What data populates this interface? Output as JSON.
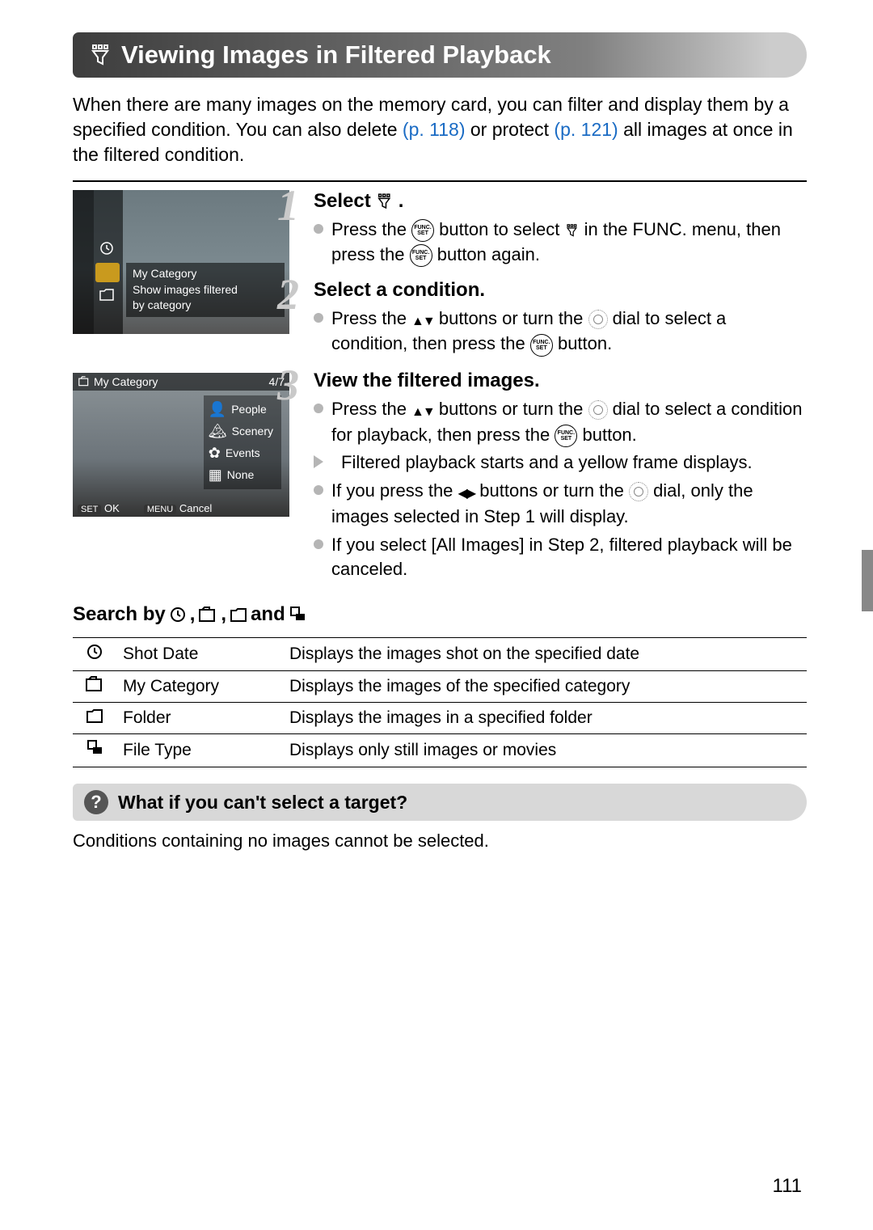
{
  "title": "Viewing Images in Filtered Playback",
  "intro": {
    "part1": "When there are many images on the memory card, you can filter and display them by a specified condition. You can also delete ",
    "link1": "(p. 118)",
    "part2": " or protect ",
    "link2": "(p. 121)",
    "part3": " all images at once in the filtered condition."
  },
  "screenshot1": {
    "line1": "My Category",
    "line2": "Show images filtered",
    "line3": "by category"
  },
  "screenshot2": {
    "header_left": "My Category",
    "header_right": "4/7",
    "items": [
      "People",
      "Scenery",
      "Events",
      "None"
    ],
    "footer_set": "SET",
    "footer_ok": "OK",
    "footer_menu": "MENU",
    "footer_cancel": "Cancel"
  },
  "steps": [
    {
      "num": "1",
      "title": "Select",
      "bullets": [
        {
          "type": "circle",
          "pre": "Press the ",
          "mid": " button to select ",
          "post": " in the FUNC. menu, then press the ",
          "end": " button again."
        }
      ]
    },
    {
      "num": "2",
      "title": "Select a condition.",
      "bullet1_pre": "Press the ",
      "bullet1_mid": " buttons or turn the ",
      "bullet1_mid2": " dial to select a condition, then press the ",
      "bullet1_end": " button."
    },
    {
      "num": "3",
      "title": "View the filtered images.",
      "b1_pre": "Press the ",
      "b1_mid": " buttons or turn the ",
      "b1_mid2": " dial to select a condition for playback, then press the ",
      "b1_end": " button.",
      "b2": "Filtered playback starts and a yellow frame displays.",
      "b3_pre": "If you press the ",
      "b3_mid": " buttons or turn the ",
      "b3_end": " dial, only the images selected in Step 1 will display.",
      "b4": "If you select [All Images] in Step 2, filtered playback will be canceled."
    }
  ],
  "search_heading_pre": "Search by ",
  "search_heading_post": " and ",
  "table": [
    {
      "name": "Shot Date",
      "desc": "Displays the images shot on the specified date"
    },
    {
      "name": "My Category",
      "desc": "Displays the images of the specified category"
    },
    {
      "name": "Folder",
      "desc": "Displays the images in a specified folder"
    },
    {
      "name": "File Type",
      "desc": "Displays only still images or movies"
    }
  ],
  "faq_title": "What if you can't select a target?",
  "faq_body": "Conditions containing no images cannot be selected.",
  "page_number": "111"
}
